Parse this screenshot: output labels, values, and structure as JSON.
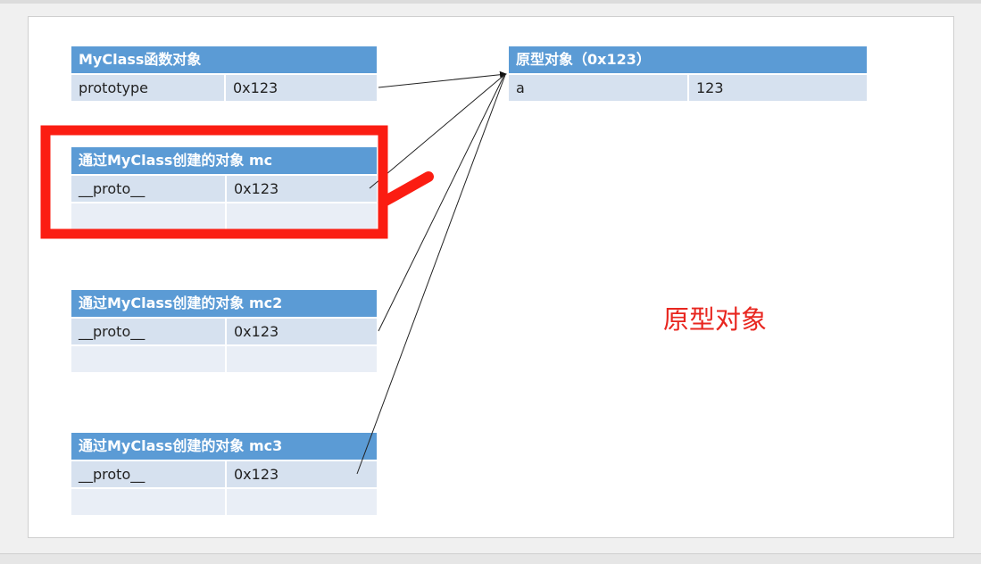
{
  "colors": {
    "header_bg": "#5b9bd5",
    "cell_bg": "#d6e1ef",
    "annotation_red": "#fb1d12",
    "caption_red": "#e8261f"
  },
  "tables": {
    "myclass": {
      "title": "MyClass函数对象",
      "rows": [
        [
          "prototype",
          "0x123"
        ]
      ]
    },
    "prototype": {
      "title": "原型对象（0x123）",
      "rows": [
        [
          "a",
          "123"
        ]
      ]
    },
    "mc": {
      "title": "通过MyClass创建的对象 mc",
      "rows": [
        [
          "__proto__",
          "0x123"
        ],
        [
          "",
          ""
        ]
      ]
    },
    "mc2": {
      "title": "通过MyClass创建的对象 mc2",
      "rows": [
        [
          "__proto__",
          "0x123"
        ],
        [
          "",
          ""
        ]
      ]
    },
    "mc3": {
      "title": "通过MyClass创建的对象 mc3",
      "rows": [
        [
          "__proto__",
          "0x123"
        ],
        [
          "",
          ""
        ]
      ]
    }
  },
  "caption": "原型对象"
}
